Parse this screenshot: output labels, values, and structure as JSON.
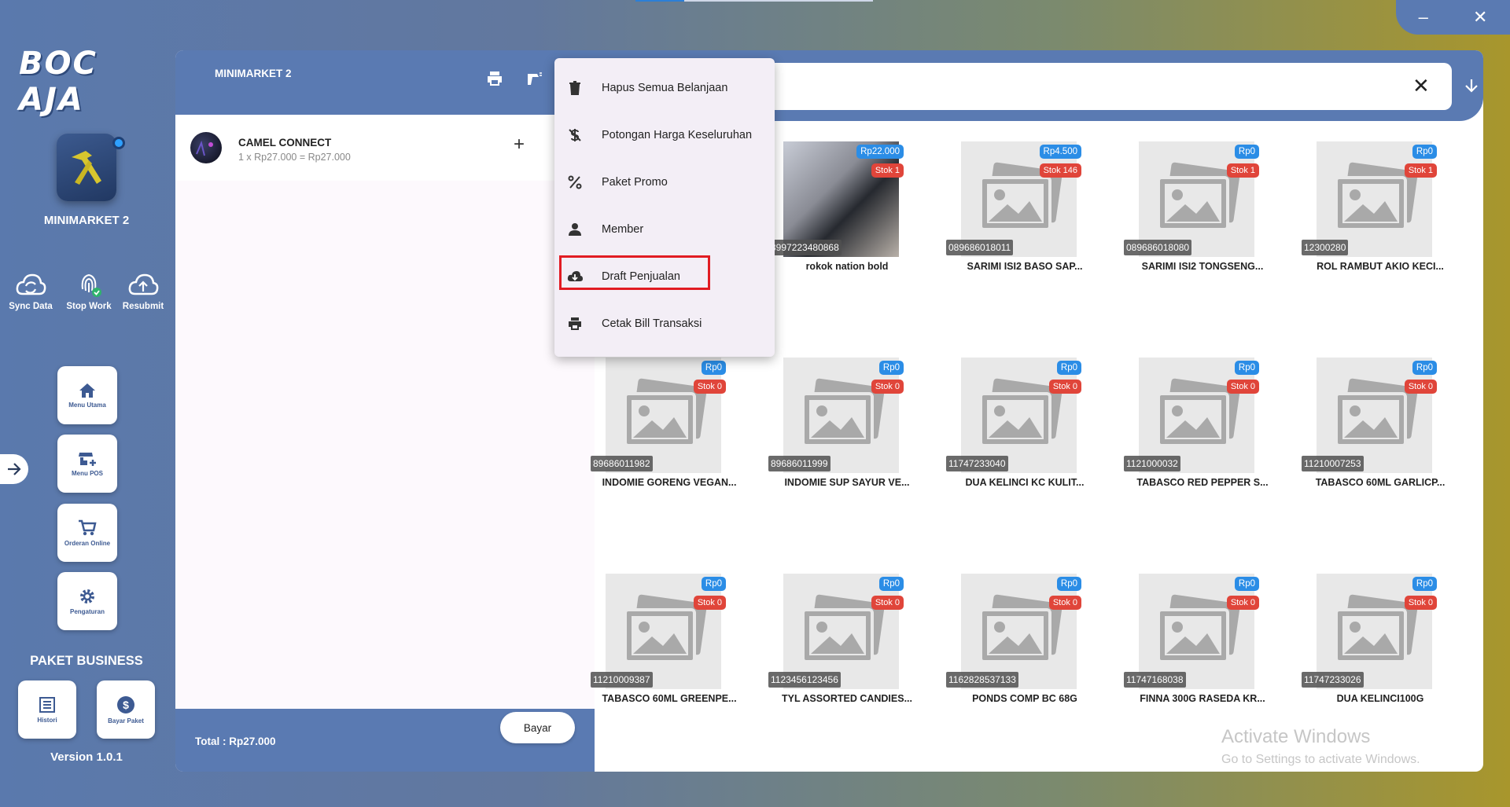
{
  "window": {
    "minimize_label": "–",
    "close_label": "✕"
  },
  "sidebar": {
    "logo_text": "BOC AJA",
    "store_name": "MINIMARKET 2",
    "quick_actions": [
      {
        "label": "Sync Data",
        "icon": "sync-cloud-icon"
      },
      {
        "label": "Stop Work",
        "icon": "fingerprint-icon"
      },
      {
        "label": "Resubmit",
        "icon": "cloud-upload-icon"
      }
    ],
    "nav": [
      {
        "label": "Menu Utama",
        "icon": "home-icon"
      },
      {
        "label": "Menu POS",
        "icon": "store-add-icon"
      },
      {
        "label": "Orderan Online",
        "icon": "cart-icon"
      },
      {
        "label": "Pengaturan",
        "icon": "gear-icon"
      }
    ],
    "paket_title": "PAKET BUSINESS",
    "paket_buttons": [
      {
        "label": "Histori",
        "icon": "list-icon"
      },
      {
        "label": "Bayar Paket",
        "icon": "dollar-icon"
      }
    ],
    "version": "Version 1.0.1"
  },
  "cart": {
    "title": "MINIMARKET 2",
    "items": [
      {
        "name": "CAMEL CONNECT",
        "detail": "1 x Rp27.000 = Rp27.000"
      }
    ],
    "add_label": "+",
    "total_label": "Total :  Rp27.000",
    "pay_label": "Bayar"
  },
  "search": {
    "clear_label": "✕"
  },
  "menu": {
    "items": [
      {
        "label": "Hapus Semua Belanjaan",
        "icon": "trash-icon"
      },
      {
        "label": "Potongan Harga Keseluruhan",
        "icon": "price-off-icon"
      },
      {
        "label": "Paket Promo",
        "icon": "percent-icon"
      },
      {
        "label": "Member",
        "icon": "person-icon"
      },
      {
        "label": "Draft Penjualan",
        "icon": "cloud-download-icon"
      },
      {
        "label": "Cetak Bill Transaksi",
        "icon": "printer-icon"
      }
    ],
    "highlighted_index": 4
  },
  "products": [
    {
      "name": "rokok nation bold",
      "code": "8997223480868",
      "price": "Rp22.000",
      "stock": "Stok 1",
      "photo": true
    },
    {
      "name": "SARIMI ISI2 BASO SAP...",
      "code": "089686018011",
      "price": "Rp4.500",
      "stock": "Stok 146",
      "photo": false
    },
    {
      "name": "SARIMI ISI2 TONGSENG...",
      "code": "089686018080",
      "price": "Rp0",
      "stock": "Stok 1",
      "photo": false
    },
    {
      "name": "ROL RAMBUT AKIO KECI...",
      "code": "12300280",
      "price": "Rp0",
      "stock": "Stok 1",
      "photo": false
    },
    {
      "name": "INDOMIE GORENG VEGAN...",
      "code": "89686011982",
      "price": "Rp0",
      "stock": "Stok 0",
      "photo": false
    },
    {
      "name": "INDOMIE SUP SAYUR VE...",
      "code": "89686011999",
      "price": "Rp0",
      "stock": "Stok 0",
      "photo": false
    },
    {
      "name": "DUA KELINCI KC KULIT...",
      "code": "11747233040",
      "price": "Rp0",
      "stock": "Stok 0",
      "photo": false
    },
    {
      "name": "TABASCO RED PEPPER S...",
      "code": "1121000032",
      "price": "Rp0",
      "stock": "Stok 0",
      "photo": false
    },
    {
      "name": "TABASCO 60ML GARLICP...",
      "code": "11210007253",
      "price": "Rp0",
      "stock": "Stok 0",
      "photo": false
    },
    {
      "name": "TABASCO 60ML GREENPE...",
      "code": "11210009387",
      "price": "Rp0",
      "stock": "Stok 0",
      "photo": false
    },
    {
      "name": "TYL ASSORTED CANDIES...",
      "code": "1123456123456",
      "price": "Rp0",
      "stock": "Stok 0",
      "photo": false
    },
    {
      "name": "PONDS COMP BC 68G",
      "code": "1162828537133",
      "price": "Rp0",
      "stock": "Stok 0",
      "photo": false
    },
    {
      "name": "FINNA 300G RASEDA KR...",
      "code": "11747168038",
      "price": "Rp0",
      "stock": "Stok 0",
      "photo": false
    },
    {
      "name": "DUA KELINCI100G",
      "code": "11747233026",
      "price": "Rp0",
      "stock": "Stok 0",
      "photo": false
    }
  ],
  "watermark": {
    "line1": "Activate Windows",
    "line2": "Go to Settings to activate Windows."
  },
  "colors": {
    "brand": "#5a7ab2",
    "price_badge": "#2b8de6",
    "stock_badge": "#e0453a",
    "highlight": "#e11b22"
  }
}
